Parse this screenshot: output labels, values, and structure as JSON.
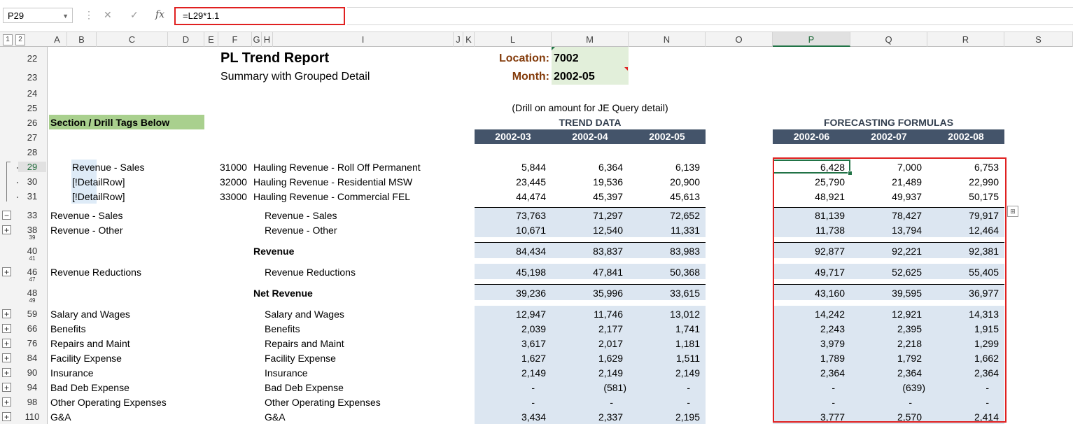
{
  "formula_bar": {
    "name_box": "P29",
    "cancel_icon": "✕",
    "enter_icon": "✓",
    "fx_label": "fx",
    "formula": "=L29*1.1"
  },
  "outline_levels": [
    "1",
    "2"
  ],
  "columns": [
    "A",
    "B",
    "C",
    "D",
    "E",
    "F",
    "G",
    "H",
    "I",
    "J",
    "K",
    "L",
    "M",
    "N",
    "O",
    "P",
    "Q",
    "R",
    "S"
  ],
  "rows": [
    "22",
    "23",
    "24",
    "25",
    "26",
    "27",
    "28",
    "29",
    "30",
    "31",
    "33",
    "38",
    "39",
    "40",
    "41",
    "46",
    "47",
    "48",
    "49",
    "59",
    "66",
    "76",
    "84",
    "90",
    "94",
    "98",
    "110"
  ],
  "report": {
    "title": "PL Trend Report",
    "subtitle": "Summary with Grouped Detail",
    "location_label": "Location:",
    "location_value": "7002",
    "month_label": "Month:",
    "month_value": "2002-05",
    "drill_note": "(Drill on amount for JE Query detail)",
    "section_tag": "Section / Drill Tags Below",
    "trend_title": "TREND DATA",
    "forecast_title": "FORECASTING FORMULAS",
    "trend_periods": [
      "2002-03",
      "2002-04",
      "2002-05"
    ],
    "forecast_periods": [
      "2002-06",
      "2002-07",
      "2002-08"
    ]
  },
  "detail_rows": [
    {
      "tag": "Revenue - Sales",
      "account": "31000",
      "desc": "Hauling Revenue - Roll Off Permanent",
      "trend": [
        "5,844",
        "6,364",
        "6,139"
      ],
      "forecast": [
        "6,428",
        "7,000",
        "6,753"
      ]
    },
    {
      "tag": "[!DetailRow]",
      "account": "32000",
      "desc": "Hauling Revenue - Residential MSW",
      "trend": [
        "23,445",
        "19,536",
        "20,900"
      ],
      "forecast": [
        "25,790",
        "21,489",
        "22,990"
      ]
    },
    {
      "tag": "[!DetailRow]",
      "account": "33000",
      "desc": "Hauling Revenue - Commercial FEL",
      "trend": [
        "44,474",
        "45,397",
        "45,613"
      ],
      "forecast": [
        "48,921",
        "49,937",
        "50,175"
      ]
    }
  ],
  "summary_rows": [
    {
      "tag": "Revenue - Sales",
      "label": "Revenue - Sales",
      "trend": [
        "73,763",
        "71,297",
        "72,652"
      ],
      "forecast": [
        "81,139",
        "78,427",
        "79,917"
      ]
    },
    {
      "tag": "Revenue - Other",
      "label": "Revenue - Other",
      "trend": [
        "10,671",
        "12,540",
        "11,331"
      ],
      "forecast": [
        "11,738",
        "13,794",
        "12,464"
      ]
    },
    {
      "tag": "",
      "label": "Revenue",
      "trend": [
        "84,434",
        "83,837",
        "83,983"
      ],
      "forecast": [
        "92,877",
        "92,221",
        "92,381"
      ]
    },
    {
      "tag": "Revenue Reductions",
      "label": "Revenue Reductions",
      "trend": [
        "45,198",
        "47,841",
        "50,368"
      ],
      "forecast": [
        "49,717",
        "52,625",
        "55,405"
      ]
    },
    {
      "tag": "",
      "label": "Net Revenue",
      "trend": [
        "39,236",
        "35,996",
        "33,615"
      ],
      "forecast": [
        "43,160",
        "39,595",
        "36,977"
      ]
    },
    {
      "tag": "Salary and Wages",
      "label": "Salary and Wages",
      "trend": [
        "12,947",
        "11,746",
        "13,012"
      ],
      "forecast": [
        "14,242",
        "12,921",
        "14,313"
      ]
    },
    {
      "tag": "Benefits",
      "label": "Benefits",
      "trend": [
        "2,039",
        "2,177",
        "1,741"
      ],
      "forecast": [
        "2,243",
        "2,395",
        "1,915"
      ]
    },
    {
      "tag": "Repairs and Maint",
      "label": "Repairs and Maint",
      "trend": [
        "3,617",
        "2,017",
        "1,181"
      ],
      "forecast": [
        "3,979",
        "2,218",
        "1,299"
      ]
    },
    {
      "tag": "Facility Expense",
      "label": "Facility Expense",
      "trend": [
        "1,627",
        "1,629",
        "1,511"
      ],
      "forecast": [
        "1,789",
        "1,792",
        "1,662"
      ]
    },
    {
      "tag": "Insurance",
      "label": "Insurance",
      "trend": [
        "2,149",
        "2,149",
        "2,149"
      ],
      "forecast": [
        "2,364",
        "2,364",
        "2,364"
      ]
    },
    {
      "tag": "Bad Deb Expense",
      "label": "Bad Deb Expense",
      "trend": [
        "-",
        "(581)",
        "-"
      ],
      "forecast": [
        "-",
        "(639)",
        "-"
      ]
    },
    {
      "tag": "Other Operating Expenses",
      "label": "Other Operating Expenses",
      "trend": [
        "-",
        "-",
        "-"
      ],
      "forecast": [
        "-",
        "-",
        "-"
      ]
    },
    {
      "tag": "G&A",
      "label": "G&A",
      "trend": [
        "3,434",
        "2,337",
        "2,195"
      ],
      "forecast": [
        "3,777",
        "2,570",
        "2,414"
      ]
    }
  ],
  "outline_buttons": [
    "−",
    "+",
    "+",
    "+",
    "+",
    "+",
    "+",
    "+",
    "+",
    "+",
    "+"
  ],
  "colors": {
    "header_band": "#44546a",
    "value_band": "#dce6f1",
    "tag_fill": "#a9d08e",
    "input_fill": "#e2efda",
    "label_brown": "#843c0c",
    "highlight_red": "#e02020"
  }
}
